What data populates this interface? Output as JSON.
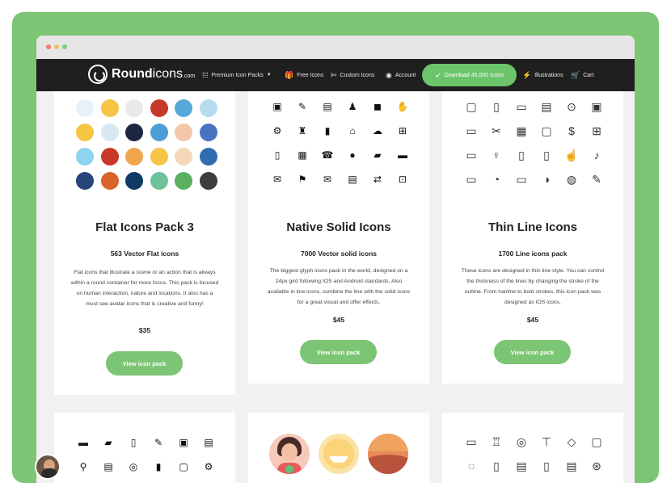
{
  "brand": {
    "name_bold": "Round",
    "name_light": "icons",
    "domain": ".com"
  },
  "colors": {
    "accent": "#7dc575",
    "nav_bg": "#1f1f1f",
    "button": "#7cc574"
  },
  "nav": {
    "premium": "Premium Icon Packs",
    "free": "Free Icons",
    "custom": "Custom Icons",
    "account": "Account",
    "download": "Download 45,000 Icons",
    "illustrations": "Illustrations",
    "cart": "Cart"
  },
  "cards": [
    {
      "title": "Flat Icons Pack 3",
      "subtitle": "563 Vector Flat icons",
      "description": "Flat icons that illustrate a scene or an action that is always within a round container for more focus. This pack is focused on human interaction, nature and locations. It also has a must see avatar icons that is creative and funny!",
      "price": "$35",
      "button": "View icon pack"
    },
    {
      "title": "Native Solid Icons",
      "subtitle": "7000 Vector solid icons",
      "description": "The biggest glyph icons pack in the world, designed on a 24px gird following IOS and Android standards. Also available in line icons, combine the line with the solid icons for a great visual and offer effects.",
      "price": "$45",
      "button": "View icon pack"
    },
    {
      "title": "Thin Line Icons",
      "subtitle": "1700 Line icons pack",
      "description": "These icons are designed in thin line style. You can control the thickness of the lines by changing the stroke of the outline. From hairline to bold strokes, this icon pack was designed as IOS icons.",
      "price": "$45",
      "button": "View icon pack"
    }
  ],
  "icons": {
    "solid": [
      "▣",
      "✎",
      "▤",
      "♟",
      "◼",
      "✋",
      "⚙",
      "♜",
      "▮",
      "⌂",
      "☁",
      "⊞",
      "▯",
      "▦",
      "☎",
      "●",
      "▰",
      "▬",
      "✉",
      "⚑",
      "✉",
      "▤",
      "⇄",
      "⊡"
    ],
    "line": [
      "▢",
      "▯",
      "▭",
      "▤",
      "⊙",
      "▣",
      "▭",
      "✂",
      "▦",
      "▢",
      "$",
      "⊞",
      "▭",
      "♀",
      "▯",
      "▯",
      "☝",
      "♪",
      "▭",
      "◔",
      "▭",
      "◑",
      "◍",
      "✎"
    ],
    "solid2": [
      "▬",
      "▰",
      "▯",
      "✎",
      "▣",
      "▤",
      "⚲",
      "▤",
      "◎",
      "▮",
      "▢",
      "⚙"
    ],
    "line2": [
      "▭",
      "♖",
      "◎",
      "⊤",
      "◇",
      "▢",
      "◌",
      "▯",
      "▤",
      "▯",
      "▤",
      "⊛"
    ]
  }
}
